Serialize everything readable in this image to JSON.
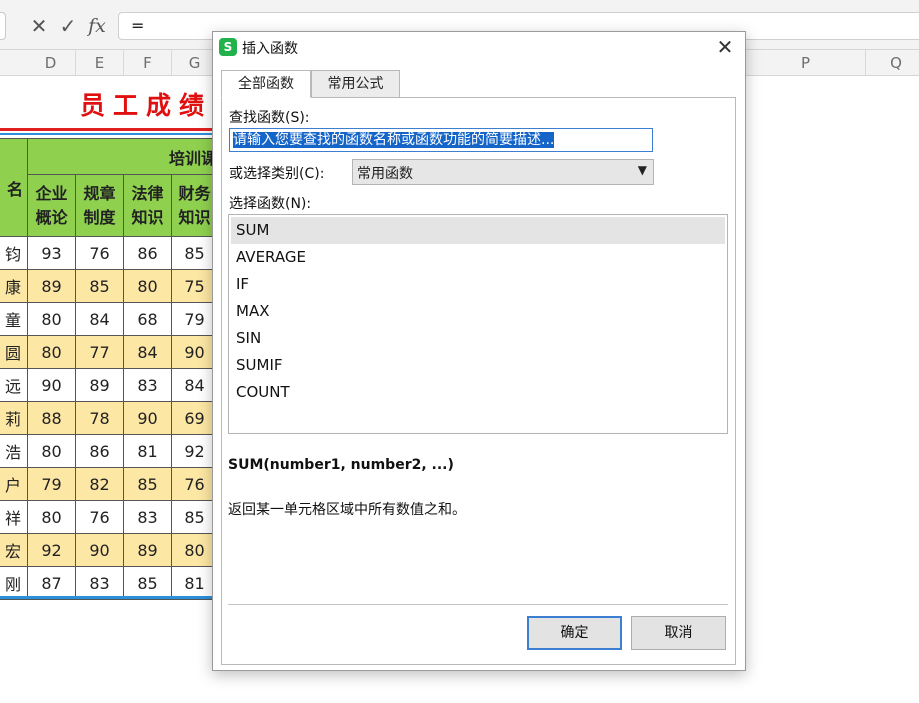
{
  "formula_bar": {
    "cancel_icon": "close-icon",
    "confirm_icon": "check-icon",
    "fx_label": "fx",
    "formula": "="
  },
  "columns": [
    "D",
    "E",
    "F",
    "G",
    "P",
    "Q"
  ],
  "sheet": {
    "title": "员工成绩",
    "group_header": "培训课",
    "partial_header_left": "名",
    "headers": [
      [
        "企业",
        "概论"
      ],
      [
        "规章",
        "制度"
      ],
      [
        "法律",
        "知识"
      ],
      [
        "财务",
        "知识"
      ]
    ],
    "rows": [
      {
        "name": "钧",
        "scores": [
          "93",
          "76",
          "86",
          "85"
        ]
      },
      {
        "name": "康",
        "scores": [
          "89",
          "85",
          "80",
          "75"
        ]
      },
      {
        "name": "童",
        "scores": [
          "80",
          "84",
          "68",
          "79"
        ]
      },
      {
        "name": "圆",
        "scores": [
          "80",
          "77",
          "84",
          "90"
        ]
      },
      {
        "name": "远",
        "scores": [
          "90",
          "89",
          "83",
          "84"
        ]
      },
      {
        "name": "莉",
        "scores": [
          "88",
          "78",
          "90",
          "69"
        ]
      },
      {
        "name": "浩",
        "scores": [
          "80",
          "86",
          "81",
          "92"
        ]
      },
      {
        "name": "户",
        "scores": [
          "79",
          "82",
          "85",
          "76"
        ]
      },
      {
        "name": "祥",
        "scores": [
          "80",
          "76",
          "83",
          "85"
        ]
      },
      {
        "name": "宏",
        "scores": [
          "92",
          "90",
          "89",
          "80"
        ]
      },
      {
        "name": "刚",
        "scores": [
          "87",
          "83",
          "85",
          "81"
        ]
      }
    ]
  },
  "dialog": {
    "app_icon_glyph": "S",
    "title": "插入函数",
    "tabs": [
      {
        "label": "全部函数",
        "active": true
      },
      {
        "label": "常用公式",
        "active": false
      }
    ],
    "search": {
      "label": "查找函数(S):",
      "value": "请输入您要查找的函数名称或函数功能的简要描述..."
    },
    "category": {
      "label": "或选择类别(C):",
      "value": "常用函数"
    },
    "function_list": {
      "label": "选择函数(N):",
      "items": [
        "SUM",
        "AVERAGE",
        "IF",
        "MAX",
        "SIN",
        "SUMIF",
        "COUNT"
      ],
      "selected": "SUM"
    },
    "signature": "SUM(number1, number2, ...)",
    "description": "返回某一单元格区域中所有数值之和。",
    "ok_label": "确定",
    "cancel_label": "取消"
  },
  "colors": {
    "header_green": "#8fd14f",
    "row_highlight": "#fde7a4",
    "title_red": "#e01010",
    "accent_blue": "#3c7fd1",
    "app_icon_green": "#22b24c"
  }
}
